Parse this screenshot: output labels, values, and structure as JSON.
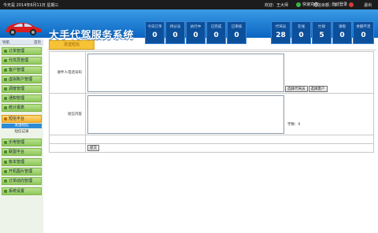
{
  "topbar": {
    "date": "今天是 2014年6月11日 星期三",
    "welcome": "欢迎：王大师",
    "recharge": "快速充值",
    "balance": "短信余额：-1",
    "autologin": "自动登录",
    "logout": "退出"
  },
  "banner": {
    "title": "大手代驾服务系统"
  },
  "stats_left": [
    {
      "label": "今日订单",
      "value": "0"
    },
    {
      "label": "待分派",
      "value": "0"
    },
    {
      "label": "执行中",
      "value": "0"
    },
    {
      "label": "已完成",
      "value": "0"
    },
    {
      "label": "已审核",
      "value": "0"
    }
  ],
  "stats_right": [
    {
      "label": "代驾员",
      "value": "28"
    },
    {
      "label": "在线",
      "value": "0"
    },
    {
      "label": "忙碌",
      "value": "5"
    },
    {
      "label": "请假",
      "value": "0"
    },
    {
      "label": "余额不足",
      "value": "0"
    }
  ],
  "sidebar": {
    "header_left": "导航",
    "header_right": "首页",
    "items": [
      "订单管理",
      "代驾员管理",
      "客户管理",
      "虚拟账户管理",
      "调度管理",
      "通知管理",
      "统计报表",
      "短信平台",
      "乐电管理",
      "联盟平台",
      "帐本管理",
      "开机图片管理",
      "订单动向管理",
      "系统设置"
    ],
    "sub_active": "发送短信",
    "sub_other": "短信记录"
  },
  "content": {
    "tab": "发送短信",
    "recipient_label": "收件人电话号码",
    "select_driver": "选择代驾员",
    "select_customer": "选择客户",
    "content_label": "短信内容",
    "char_count": "字数：0",
    "submit": "提交"
  },
  "colors": {
    "banner_top": "#3a9be6",
    "banner_bottom": "#0a65c2",
    "menu_green": "#9fd06c",
    "menu_active": "#f2b233",
    "tab_orange": "#f6c236"
  }
}
